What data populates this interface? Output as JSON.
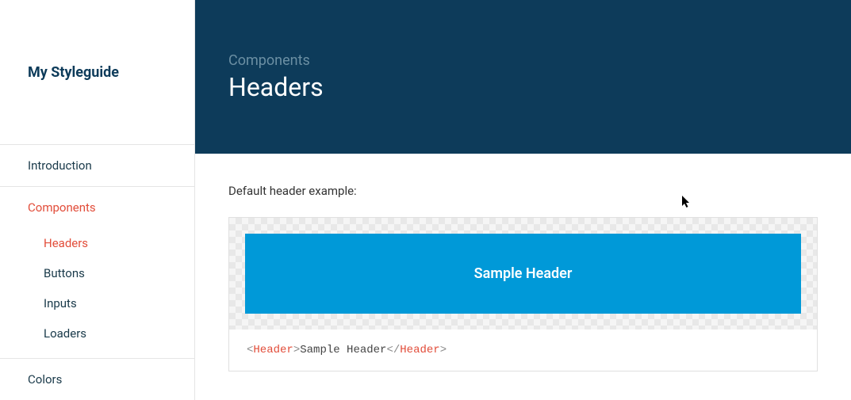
{
  "sidebar": {
    "title": "My Styleguide",
    "items": [
      {
        "label": "Introduction"
      },
      {
        "label": "Components",
        "active": true
      },
      {
        "label": "Colors"
      }
    ],
    "subitems": [
      {
        "label": "Headers",
        "active": true
      },
      {
        "label": "Buttons"
      },
      {
        "label": "Inputs"
      },
      {
        "label": "Loaders"
      }
    ]
  },
  "header": {
    "breadcrumb": "Components",
    "title": "Headers"
  },
  "main": {
    "description": "Default header example:",
    "sample_header_text": "Sample Header",
    "code": {
      "open_bracket": "<",
      "tag_open": "Header",
      "close_bracket": ">",
      "content": "Sample Header",
      "open_bracket2": "</",
      "tag_close": "Header",
      "close_bracket2": ">"
    }
  }
}
